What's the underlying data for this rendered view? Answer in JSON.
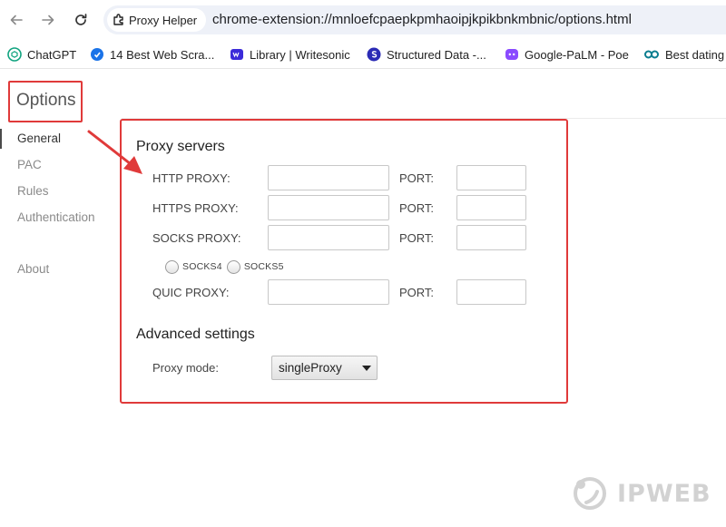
{
  "browser": {
    "tab_chip_label": "Proxy Helper",
    "url": "chrome-extension://mnloefcpaepkpmhaoipjkpikbnkmbnic/options.html",
    "bookmarks": [
      {
        "label": "ChatGPT",
        "icon": "chatgpt-icon",
        "color": "#10a37f"
      },
      {
        "label": "14 Best Web Scra...",
        "icon": "bookmark-site-icon",
        "color": "#1a73e8"
      },
      {
        "label": "Library | Writesonic",
        "icon": "writesonic-icon",
        "color": "#3b2bd9"
      },
      {
        "label": "Structured Data -...",
        "icon": "structured-data-icon",
        "color": "#2b2bb5"
      },
      {
        "label": "Google-PaLM - Poe",
        "icon": "poe-icon",
        "color": "#8a4bff"
      },
      {
        "label": "Best dating",
        "icon": "link-icon",
        "color": "#0b7d8f"
      }
    ]
  },
  "page": {
    "title": "Options",
    "sidebar": [
      {
        "label": "General",
        "active": true
      },
      {
        "label": "PAC",
        "active": false
      },
      {
        "label": "Rules",
        "active": false
      },
      {
        "label": "Authentication",
        "active": false
      },
      {
        "label": "About",
        "active": false
      }
    ],
    "proxy_servers": {
      "title": "Proxy servers",
      "port_label": "PORT:",
      "rows": [
        {
          "label": "HTTP PROXY:",
          "host": "",
          "port": ""
        },
        {
          "label": "HTTPS PROXY:",
          "host": "",
          "port": ""
        },
        {
          "label": "SOCKS PROXY:",
          "host": "",
          "port": ""
        },
        {
          "label": "QUIC PROXY:",
          "host": "",
          "port": ""
        }
      ],
      "socks_options": [
        "SOCKS4",
        "SOCKS5"
      ]
    },
    "advanced": {
      "title": "Advanced settings",
      "proxy_mode_label": "Proxy mode:",
      "proxy_mode_value": "singleProxy"
    }
  },
  "watermark": "IPWEB",
  "annotation_color": "#e03a3a"
}
